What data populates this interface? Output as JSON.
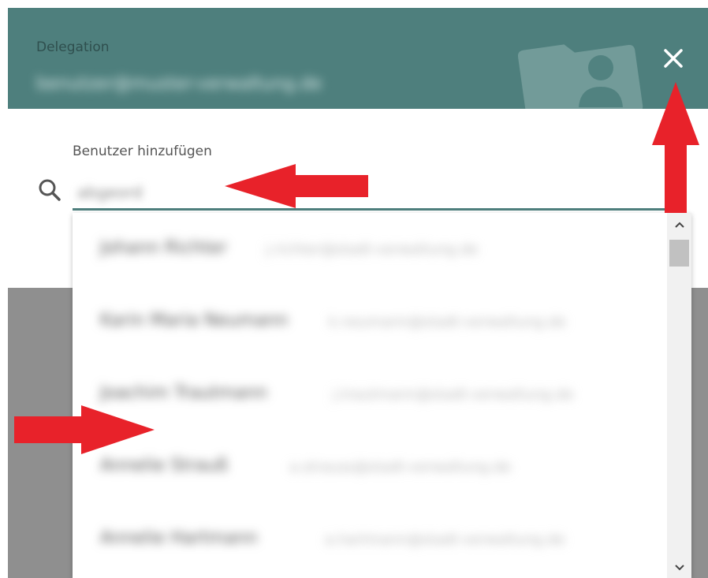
{
  "dialog": {
    "title": "Delegation",
    "subtitle": "benutzer@muster-verwaltung.de",
    "close_glyph": "✕"
  },
  "search": {
    "label": "Benutzer hinzufügen",
    "value": "abgeord"
  },
  "options": [
    {
      "name": "Johann Richter",
      "email": "j.richter@stadt-verwaltung.de"
    },
    {
      "name": "Karin Maria Neumann",
      "email": "k.neumann@stadt-verwaltung.de"
    },
    {
      "name": "Joachim Trautmann",
      "email": "j.trautmann@stadt-verwaltung.de"
    },
    {
      "name": "Annelie Strauß",
      "email": "a.strauss@stadt-verwaltung.de"
    },
    {
      "name": "Annelie Hartmann",
      "email": "a.hartmann@stadt-verwaltung.de"
    }
  ],
  "colors": {
    "header": "#4e7f7d",
    "arrow": "#e8222a",
    "overlay": "#8f8f8f"
  },
  "icons": [
    "folder-user-icon",
    "close-icon",
    "search-icon",
    "chevron-up-icon",
    "chevron-down-icon",
    "red-arrow-annotation"
  ]
}
